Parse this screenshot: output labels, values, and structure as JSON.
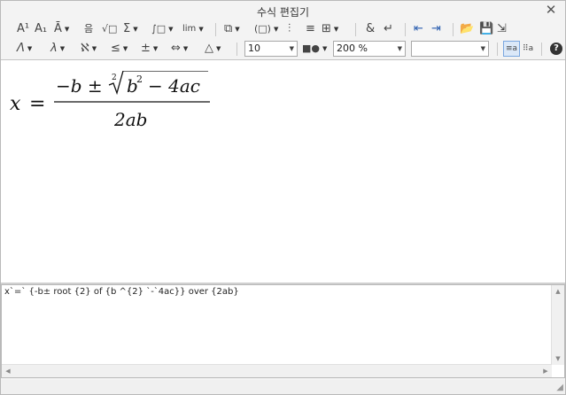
{
  "window": {
    "title": "수식 편집기"
  },
  "toolbar1": {
    "superscript": "A¹",
    "subscript": "A₁",
    "decoration": "Ā",
    "fraction": "음",
    "sqrt": "√□",
    "sum": "Σ",
    "integral": "∫□",
    "limit": "lim",
    "brackets": "(□)"
  },
  "toolbar2": {
    "greek_upper": "Λ",
    "greek_lower": "λ",
    "special_symbol": "ℵ",
    "relation": "≤",
    "operator": "±",
    "arrow": "⇔",
    "misc": "△"
  },
  "font_size": {
    "value": "10"
  },
  "zoom": {
    "value": "200 %"
  },
  "font_name": {
    "value": ""
  },
  "formula": {
    "lhs": "x",
    "eq": "=",
    "num_prefix": "−b ±",
    "root_index": "2",
    "radicand_base": "b",
    "radicand_exp": "2",
    "radicand_rest": "− 4ac",
    "denominator": "2ab"
  },
  "script": {
    "text": "x`=` {-b± root {2} of {b ^{2} `-`4ac}} over {2ab}"
  }
}
